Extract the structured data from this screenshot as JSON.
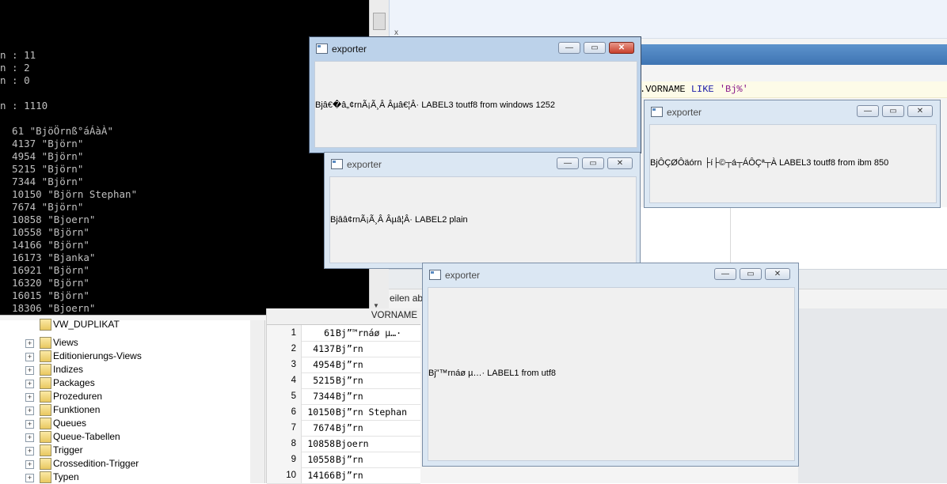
{
  "terminal": {
    "lines": [
      "n : 11",
      "n : 2",
      "n : 0",
      "",
      "n : 1110",
      "",
      "  61 \"BjöÖrnß°áÁàÀ\"",
      "  4137 \"Björn\"",
      "  4954 \"Björn\"",
      "  5215 \"Björn\"",
      "  7344 \"Björn\"",
      "  10150 \"Björn Stephan\"",
      "  7674 \"Björn\"",
      "  10858 \"Bjoern\"",
      "  10558 \"Björn\"",
      "  14166 \"Björn\"",
      "  16173 \"Bjanka\"",
      "  16921 \"Björn\"",
      "  16320 \"Björn\"",
      "  16015 \"Björn\"",
      "  18306 \"Bjoern\""
    ]
  },
  "ide": {
    "x_label": "x",
    "sql_prefix": ".VORNAME",
    "sql_keyword": "LIKE",
    "sql_string": "'Bj%'",
    "zeilen_label": "eilen abg"
  },
  "tree": {
    "items": [
      {
        "label": "VW_DUPLIKAT",
        "expander": ""
      },
      {
        "label": "Views",
        "expander": "+"
      },
      {
        "label": "Editionierungs-Views",
        "expander": "+"
      },
      {
        "label": "Indizes",
        "expander": "+"
      },
      {
        "label": "Packages",
        "expander": "+"
      },
      {
        "label": "Prozeduren",
        "expander": "+"
      },
      {
        "label": "Funktionen",
        "expander": "+"
      },
      {
        "label": "Queues",
        "expander": "+"
      },
      {
        "label": "Queue-Tabellen",
        "expander": "+"
      },
      {
        "label": "Trigger",
        "expander": "+"
      },
      {
        "label": "Crossedition-Trigger",
        "expander": "+"
      },
      {
        "label": "Typen",
        "expander": "+"
      }
    ]
  },
  "grid": {
    "header": "VORNAME",
    "rows": [
      {
        "n": "1",
        "id": "61",
        "v": "Bj”™rnáø µ…·"
      },
      {
        "n": "2",
        "id": "4137",
        "v": "Bj”rn"
      },
      {
        "n": "3",
        "id": "4954",
        "v": "Bj”rn"
      },
      {
        "n": "4",
        "id": "5215",
        "v": "Bj”rn"
      },
      {
        "n": "5",
        "id": "7344",
        "v": "Bj”rn"
      },
      {
        "n": "6",
        "id": "10150",
        "v": "Bj”rn Stephan"
      },
      {
        "n": "7",
        "id": "7674",
        "v": "Bj”rn"
      },
      {
        "n": "8",
        "id": "10858",
        "v": "Bjoern"
      },
      {
        "n": "9",
        "id": "10558",
        "v": "Bj”rn"
      },
      {
        "n": "10",
        "id": "14166",
        "v": "Bj”rn"
      }
    ]
  },
  "windows": [
    {
      "title": "exporter",
      "text": "Bjâ€�â„¢rnÃ¡Ã¸Â Âµâ€¦Â· LABEL3 toutf8 from windows 1252"
    },
    {
      "title": "exporter",
      "text": "BjÔÇØÔäórn ├í├©┬á┬ÁÔÇª┬À LABEL3 toutf8 from ibm 850"
    },
    {
      "title": "exporter",
      "text": "Bjââ¢rnÃ¡Ã¸Â Âµâ¦Â· LABEL2 plain"
    },
    {
      "title": "exporter",
      "text": "Bj”™rnáø µ…· LABEL1 from utf8"
    }
  ],
  "window_buttons": {
    "minimize": "—",
    "maximize": "▭",
    "close": "✕"
  }
}
